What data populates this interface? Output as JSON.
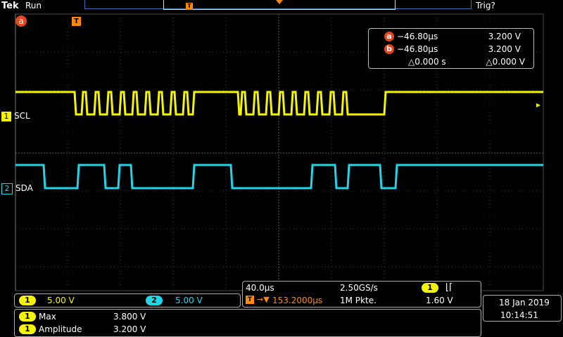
{
  "header": {
    "brand": "Tek",
    "run_state": "Run",
    "trigger_status": "Trig?",
    "trigger_marker": "T"
  },
  "cursor_marker": "a",
  "cursor_readout": {
    "a_label": "a",
    "a_time": "−46.80µs",
    "a_volt": "3.200 V",
    "b_label": "b",
    "b_time": "−46.80µs",
    "b_volt": "3.200 V",
    "delta_time": "△0.000 s",
    "delta_volt": "△0.000 V"
  },
  "channels": [
    {
      "num": "1",
      "name": "SCL",
      "scale": "5.00 V",
      "color": "#f4f400"
    },
    {
      "num": "2",
      "name": "SDA",
      "scale": "5.00 V",
      "color": "#21d4e8"
    }
  ],
  "timebase": {
    "time_per_div": "40.0µs",
    "sample_rate": "2.50GS/s",
    "trigger_pos": "153.2000µs",
    "record_length": "1M Pkte.",
    "trigger_channel": "1",
    "trigger_slope_icon": "falling-edge-icon",
    "trigger_level": "1.60 V"
  },
  "measurements": [
    {
      "channel": "1",
      "name": "Max",
      "value": "3.800 V"
    },
    {
      "channel": "1",
      "name": "Amplitude",
      "value": "3.200 V"
    }
  ],
  "datetime": {
    "date": "18 Jan  2019",
    "time": "10:14:51"
  },
  "colors": {
    "scl": "#f4f400",
    "sda": "#21d4e8",
    "grid": "#6d6d6d",
    "cursor": "#e8451c",
    "trigger": "#ff8a00"
  }
}
